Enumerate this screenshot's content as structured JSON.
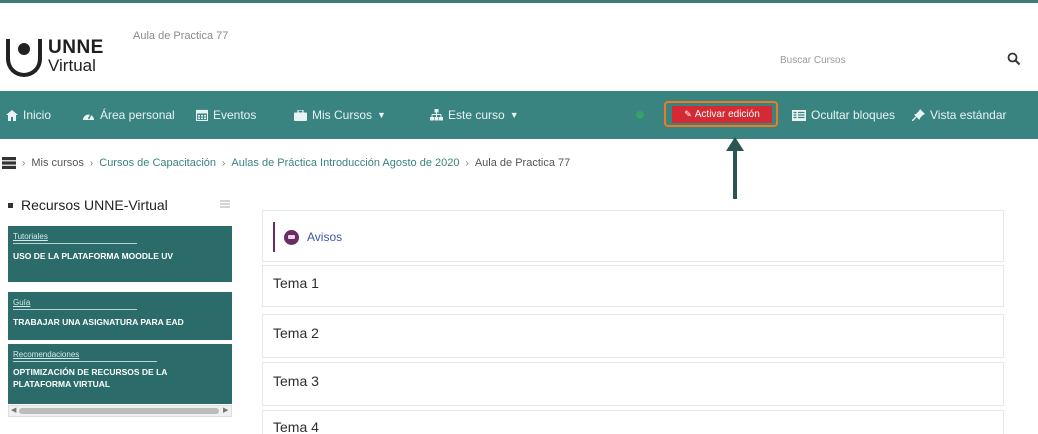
{
  "header": {
    "logo_line1": "UNNE",
    "logo_line2": "Virtual",
    "site_subtitle": "Aula de Practica 77",
    "search_placeholder": "Buscar Cursos"
  },
  "navbar": {
    "items": [
      {
        "label": "Inicio",
        "icon": "home-icon"
      },
      {
        "label": "Área personal",
        "icon": "dashboard-icon"
      },
      {
        "label": "Eventos",
        "icon": "calendar-icon"
      },
      {
        "label": "Mis Cursos",
        "icon": "briefcase-icon",
        "dropdown": true
      },
      {
        "label": "Este curso",
        "icon": "sitemap-icon",
        "dropdown": true
      }
    ],
    "edit_button_label": "Activar edición",
    "hide_blocks_label": "Ocultar bloques",
    "standard_view_label": "Vista estándar"
  },
  "breadcrumb": {
    "items": [
      "Mis cursos",
      "Cursos de Capacitación",
      "Aulas de Práctica Introducción Agosto de 2020"
    ],
    "current": "Aula de Practica 77"
  },
  "sidebar_block": {
    "title": "Recursos UNNE-Virtual",
    "cards": [
      {
        "label": "Tutoriales",
        "title": "USO DE LA PLATAFORMA MOODLE UV"
      },
      {
        "label": "Guía",
        "title": "TRABAJAR UNA ASIGNATURA PARA EAD"
      },
      {
        "label": "Recomendaciones",
        "title": "OPTIMIZACIÓN DE RECURSOS DE LA PLATAFORMA VIRTUAL"
      }
    ]
  },
  "course": {
    "avisos_label": "Avisos",
    "sections": [
      "Tema 1",
      "Tema 2",
      "Tema 3",
      "Tema 4"
    ]
  },
  "colors": {
    "navbar": "#398381",
    "edit_button": "#d42a34",
    "highlight": "#f07a20",
    "card": "#2b6b69",
    "forum": "#6b2b63"
  }
}
